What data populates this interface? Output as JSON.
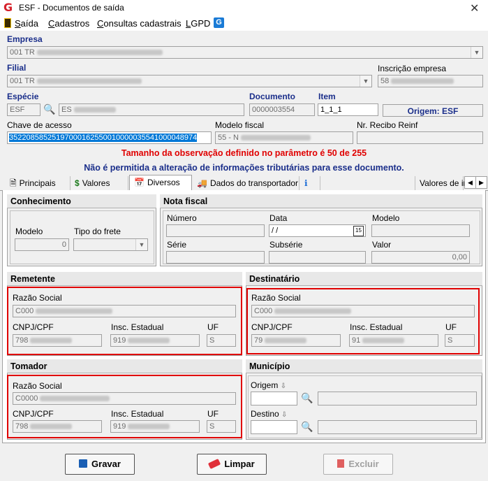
{
  "window": {
    "title": "ESF - Documentos de saída",
    "logo": "G"
  },
  "menu": [
    {
      "label": "Saída",
      "underline": "S",
      "rest": "aída"
    },
    {
      "label": "Cadastros",
      "underline": "C",
      "rest": "adastros"
    },
    {
      "label": "Consultas cadastrais",
      "underline": "C",
      "rest": "onsultas cadastrais"
    },
    {
      "label": "LGPD",
      "underline": "L",
      "rest": "GPD"
    }
  ],
  "header": {
    "empresa_label": "Empresa",
    "empresa_value": "001 TR",
    "filial_label": "Filial",
    "filial_value": "001 TR",
    "inscricao_label": "Inscrição empresa",
    "inscricao_value": "58",
    "especie_label": "Espécie",
    "especie_code": "ESF",
    "especie_desc": "ES",
    "documento_label": "Documento",
    "documento_value": "0000003554",
    "item_label": "Item",
    "item_value": "1_1_1",
    "origem_text": "Origem: ESF",
    "chave_label": "Chave de acesso",
    "chave_value": "35220858525197000162550010000035541000048974",
    "modelo_fiscal_label": "Modelo fiscal",
    "modelo_fiscal_value": "55 - N",
    "recibo_label": "Nr. Recibo Reinf",
    "recibo_value": ""
  },
  "messages": {
    "warning_red": "Tamanho da observação definido no parâmetro é 50 de 255",
    "warning_blue": "Não é permitida a alteração de informações tributárias para esse documento."
  },
  "tabs": [
    "Principais",
    "Valores",
    "Diversos",
    "Dados do transportador",
    "",
    "Valores de ir"
  ],
  "conhecimento": {
    "title": "Conhecimento",
    "modelo_label": "Modelo",
    "modelo_value": "0",
    "frete_label": "Tipo do frete"
  },
  "nota_fiscal": {
    "title": "Nota fiscal",
    "numero_label": "Número",
    "data_label": "Data",
    "data_value": " / /",
    "modelo_label": "Modelo",
    "serie_label": "Série",
    "subserie_label": "Subsérie",
    "valor_label": "Valor",
    "valor_value": "0,00"
  },
  "remetente": {
    "title": "Remetente",
    "razao_label": "Razão Social",
    "razao_value": "C000",
    "cnpj_label": "CNPJ/CPF",
    "cnpj_value": "798",
    "ie_label": "Insc. Estadual",
    "ie_value": "919",
    "uf_label": "UF",
    "uf_value": "S"
  },
  "destinatario": {
    "title": "Destinatário",
    "razao_label": "Razão Social",
    "razao_value": "C000",
    "cnpj_label": "CNPJ/CPF",
    "cnpj_value": "79",
    "ie_label": "Insc. Estadual",
    "ie_value": "91",
    "uf_label": "UF",
    "uf_value": "S"
  },
  "tomador": {
    "title": "Tomador",
    "razao_label": "Razão Social",
    "razao_value": "C0000",
    "cnpj_label": "CNPJ/CPF",
    "cnpj_value": "798",
    "ie_label": "Insc. Estadual",
    "ie_value": "919",
    "uf_label": "UF",
    "uf_value": "S"
  },
  "municipio": {
    "title": "Município",
    "origem_label": "Origem",
    "destino_label": "Destino"
  },
  "buttons": {
    "gravar": "Gravar",
    "limpar": "Limpar",
    "excluir": "Excluir"
  },
  "colors": {
    "red": "#e00000",
    "blue_label": "#1a2e8a",
    "selection": "#0078d7"
  }
}
